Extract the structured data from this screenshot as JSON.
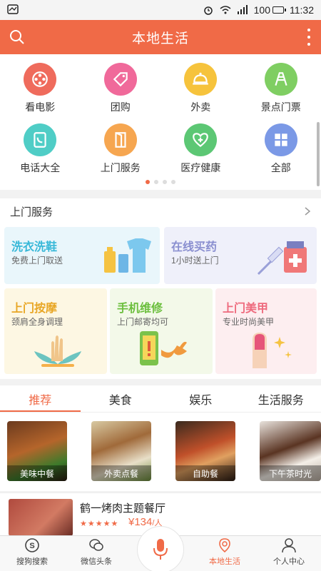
{
  "status_bar": {
    "battery": "100",
    "time": "11:32"
  },
  "header": {
    "title": "本地生活",
    "search_icon": "search-icon",
    "more_icon": "more-vertical-icon"
  },
  "categories": [
    {
      "label": "看电影",
      "icon": "film-reel-icon",
      "color": "#ef6b5c"
    },
    {
      "label": "团购",
      "icon": "tag-icon",
      "color": "#f0699a"
    },
    {
      "label": "外卖",
      "icon": "cloche-icon",
      "color": "#f6c33c"
    },
    {
      "label": "景点门票",
      "icon": "tower-icon",
      "color": "#7fce62"
    },
    {
      "label": "电话大全",
      "icon": "phonebook-icon",
      "color": "#4fcdc6"
    },
    {
      "label": "上门服务",
      "icon": "door-icon",
      "color": "#f6a650"
    },
    {
      "label": "医疗健康",
      "icon": "heart-plus-icon",
      "color": "#5cc774"
    },
    {
      "label": "全部",
      "icon": "grid-icon",
      "color": "#7b99e6"
    }
  ],
  "services": {
    "title": "上门服务",
    "cards": [
      {
        "title": "洗衣洗鞋",
        "subtitle": "免费上门取送",
        "color": "#38b8d8"
      },
      {
        "title": "在线买药",
        "subtitle": "1小时送上门",
        "color": "#8a8fd0"
      },
      {
        "title": "上门按摩",
        "subtitle": "颈肩全身调理",
        "color": "#e8a624"
      },
      {
        "title": "手机维修",
        "subtitle": "上门邮寄均可",
        "color": "#6cbf3e"
      },
      {
        "title": "上门美甲",
        "subtitle": "专业时尚美甲",
        "color": "#ee6a7d"
      }
    ]
  },
  "tabs": [
    "推荐",
    "美食",
    "娱乐",
    "生活服务"
  ],
  "active_tab": 0,
  "tiles": [
    "美味中餐",
    "外卖点餐",
    "自助餐",
    "下午茶时光"
  ],
  "listing": {
    "name": "鹤一烤肉主题餐厅",
    "stars": "★★★★★",
    "price": "¥134",
    "price_unit": "/人"
  },
  "bottom_nav": [
    {
      "label": "搜狗搜索",
      "icon": "sogou-search-icon"
    },
    {
      "label": "微信头条",
      "icon": "wechat-news-icon"
    },
    {
      "label": "",
      "icon": "microphone-icon"
    },
    {
      "label": "本地生活",
      "icon": "location-pin-icon"
    },
    {
      "label": "个人中心",
      "icon": "person-icon"
    }
  ],
  "colors": {
    "accent": "#f06a47"
  }
}
